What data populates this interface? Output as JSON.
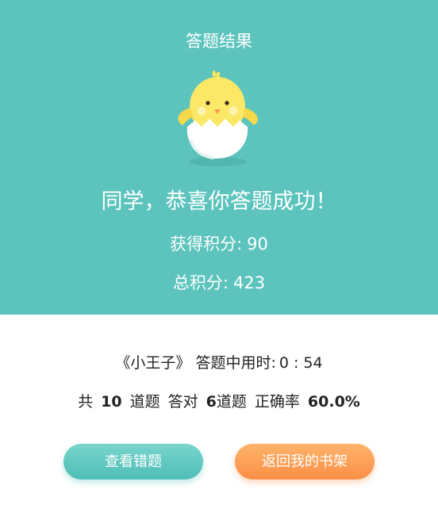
{
  "header": {
    "title": "答题结果"
  },
  "result": {
    "congrats": "同学，恭喜你答题成功！",
    "earned_label": "获得积分:",
    "earned_value": "90",
    "total_label": "总积分:",
    "total_value": "423"
  },
  "summary": {
    "book_title": "《小王子》",
    "time_label": "答题中用时:",
    "time_value": "0 : 54",
    "total_prefix": "共",
    "total_count": "10",
    "total_suffix": "道题",
    "correct_prefix": "答对",
    "correct_count": "6",
    "correct_suffix": "道题",
    "accuracy_label": "正确率",
    "accuracy_value": "60.0%"
  },
  "buttons": {
    "view_wrong": "查看错题",
    "back_shelf": "返回我的书架"
  },
  "colors": {
    "header_bg": "#5cc4bd",
    "teal_button": "#5cc8c0",
    "orange_button": "#fd9a52"
  },
  "icons": {
    "mascot": "chick-in-eggshell-icon"
  }
}
